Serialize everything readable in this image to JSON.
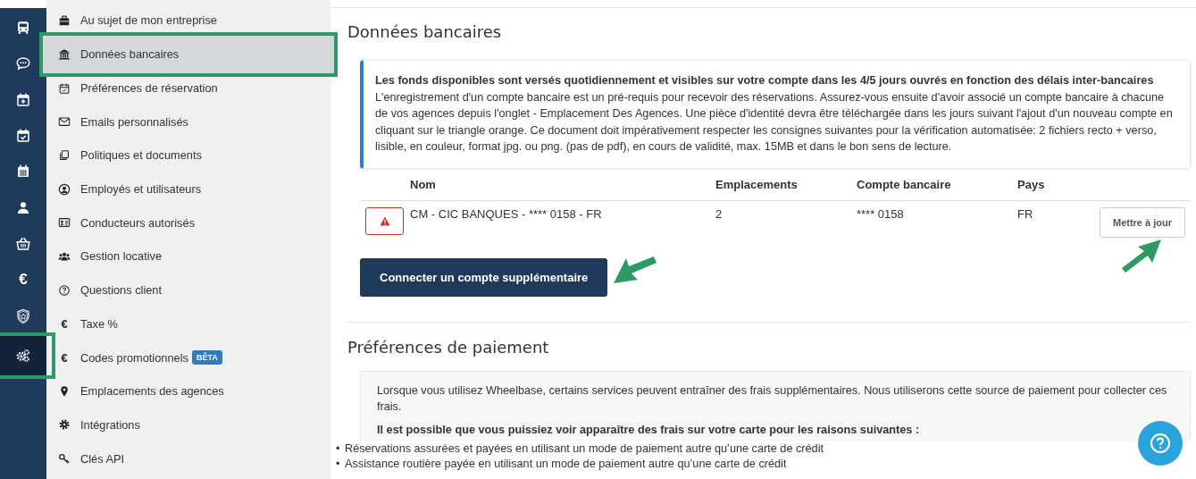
{
  "rail": {
    "items": [
      {
        "selected": false,
        "highlighted": false
      },
      {
        "selected": false,
        "highlighted": false
      },
      {
        "selected": false,
        "highlighted": false
      },
      {
        "selected": false,
        "highlighted": false
      },
      {
        "selected": false,
        "highlighted": false
      },
      {
        "selected": false,
        "highlighted": false
      },
      {
        "selected": false,
        "highlighted": false
      },
      {
        "glyph": "€",
        "selected": false,
        "highlighted": false
      },
      {
        "selected": false,
        "highlighted": false
      },
      {
        "selected": true,
        "highlighted": true
      }
    ]
  },
  "sidebar": {
    "items": [
      {
        "label": "Au sujet de mon entreprise",
        "selected": false,
        "highlighted": false
      },
      {
        "label": "Données bancaires",
        "selected": true,
        "highlighted": true
      },
      {
        "label": "Préférences de réservation",
        "selected": false,
        "highlighted": false
      },
      {
        "label": "Emails personnalisés",
        "selected": false,
        "highlighted": false
      },
      {
        "label": "Politiques et documents",
        "selected": false,
        "highlighted": false
      },
      {
        "label": "Employés et utilisateurs",
        "selected": false,
        "highlighted": false
      },
      {
        "label": "Conducteurs autorisés",
        "selected": false,
        "highlighted": false
      },
      {
        "label": "Gestion locative",
        "selected": false,
        "highlighted": false
      },
      {
        "label": "Questions client",
        "selected": false,
        "highlighted": false
      },
      {
        "glyph": "€",
        "label": "Taxe %",
        "selected": false,
        "highlighted": false
      },
      {
        "glyph": "€",
        "label": "Codes promotionnels",
        "badge": "BÊTA",
        "selected": false,
        "highlighted": false
      },
      {
        "label": "Emplacements des agences",
        "selected": false,
        "highlighted": false
      },
      {
        "label": "Intégrations",
        "selected": false,
        "highlighted": false
      },
      {
        "label": "Clés API",
        "selected": false,
        "highlighted": false
      }
    ]
  },
  "bank": {
    "title": "Données bancaires",
    "notice": {
      "heading": "Les fonds disponibles sont versés quotidiennement et visibles sur votre compte dans les 4/5 jours ouvrés en fonction des délais inter-bancaires",
      "body": "L'enregistrement d'un compte bancaire est un pré-requis pour recevoir des réservations. Assurez-vous ensuite d'avoir associé un compte bancaire à chacune de vos agences depuis l'onglet - Emplacement Des Agences. Une pièce d'identité devra être téléchargée dans les jours suivant l'ajout d'un nouveau compte en cliquant sur le triangle orange. Ce document doit impérativement respecter les consignes suivantes pour la vérification automatisée: 2 fichiers recto + verso, lisible, en couleur, format jpg. ou png. (pas de pdf), en cours de validité, max. 15MB et dans le bon sens de lecture."
    },
    "table": {
      "columns": [
        "Nom",
        "Emplacements",
        "Compte bancaire",
        "Pays"
      ],
      "rows": [
        {
          "warning": true,
          "name": "CM - CIC BANQUES - **** 0158 - FR",
          "locations": "2",
          "account": "**** 0158",
          "country": "FR",
          "action": "Mettre à jour",
          "pointed": true
        }
      ]
    },
    "connect_button": {
      "label": "Connecter un compte supplémentaire",
      "pointed": true
    }
  },
  "payment": {
    "title": "Préférences de paiement",
    "intro": "Lorsque vous utilisez Wheelbase, certains services peuvent entraîner des frais supplémentaires. Nous utiliserons cette source de paiement pour collecter ces frais.",
    "heading": "Il est possible que vous puissiez voir apparaître des frais sur votre carte pour les raisons suivantes :",
    "bullets": [
      {
        "marker": "•",
        "text": "Réservations assurées et payées en utilisant un mode de paiement autre qu’une carte de crédit"
      },
      {
        "marker": "•",
        "text": "Assistance routière payée en utilisant un mode de paiement autre qu’une carte de crédit"
      }
    ]
  }
}
